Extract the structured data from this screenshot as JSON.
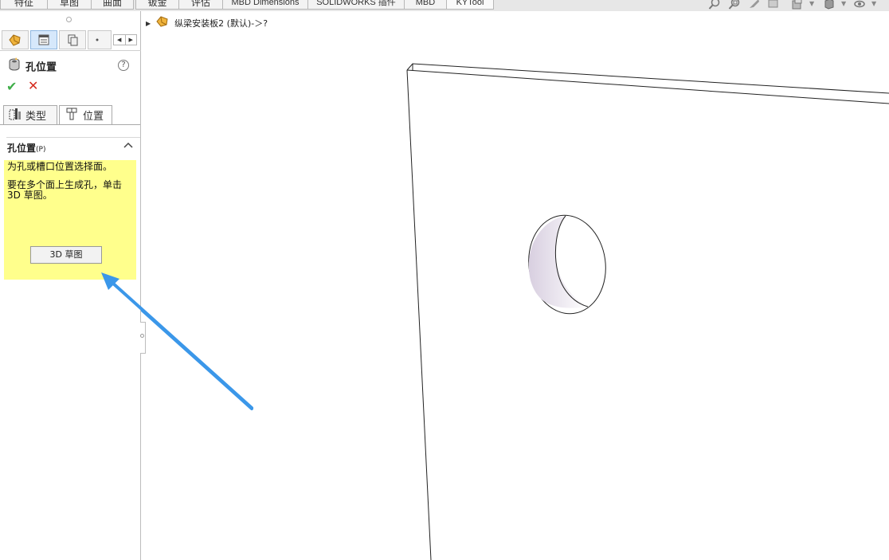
{
  "toolbar": {
    "tabs": [
      "特征",
      "草图",
      "曲面",
      "钣金",
      "评估",
      "MBD Dimensions",
      "SOLIDWORKS 插件",
      "MBD",
      "KYTool"
    ],
    "icons": [
      "zoom-to-fit-icon",
      "zoom-to-area-icon",
      "previous-view-icon",
      "section-view-icon",
      "view-orientation-icon",
      "display-style-icon",
      "hide-show-items-icon"
    ]
  },
  "manager_tabs": [
    "featuremanager-icon",
    "propertymanager-icon",
    "configurationmanager-icon",
    "more-tabs-icon"
  ],
  "property_manager": {
    "title": "孔位置",
    "tabs": {
      "type_label": "类型",
      "position_label": "位置"
    },
    "section": {
      "title": "孔位置",
      "shortcut": "(P)"
    },
    "message": {
      "line1": "为孔或槽口位置选择面。",
      "line2": "要在多个面上生成孔，单击 3D 草图。"
    },
    "sketch3d_button": "3D 草图"
  },
  "tree": {
    "part_name": "纵梁安装板2 (默认)-＞?"
  },
  "colors": {
    "message_background": "#ffff8c",
    "annotation_arrow": "#3b97e9",
    "ok_green": "#3fae49",
    "cancel_red": "#d52b1e"
  }
}
